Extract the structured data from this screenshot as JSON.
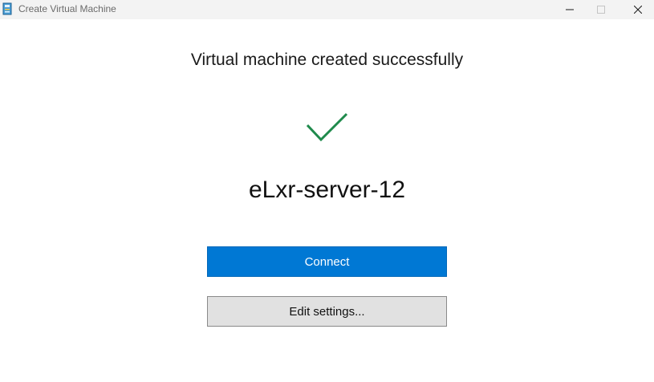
{
  "window": {
    "title": "Create Virtual Machine",
    "icon": "virtual-machine-icon",
    "controls": [
      "minimize-icon",
      "maximize-icon",
      "close-icon"
    ]
  },
  "main": {
    "heading": "Virtual machine created successfully",
    "status_icon": "checkmark-icon",
    "vm_name": "eLxr-server-12",
    "connect_label": "Connect",
    "edit_settings_label": "Edit settings..."
  },
  "colors": {
    "accent": "#0078d4",
    "success": "#1f8a4c",
    "secondary_button": "#e1e1e1"
  }
}
